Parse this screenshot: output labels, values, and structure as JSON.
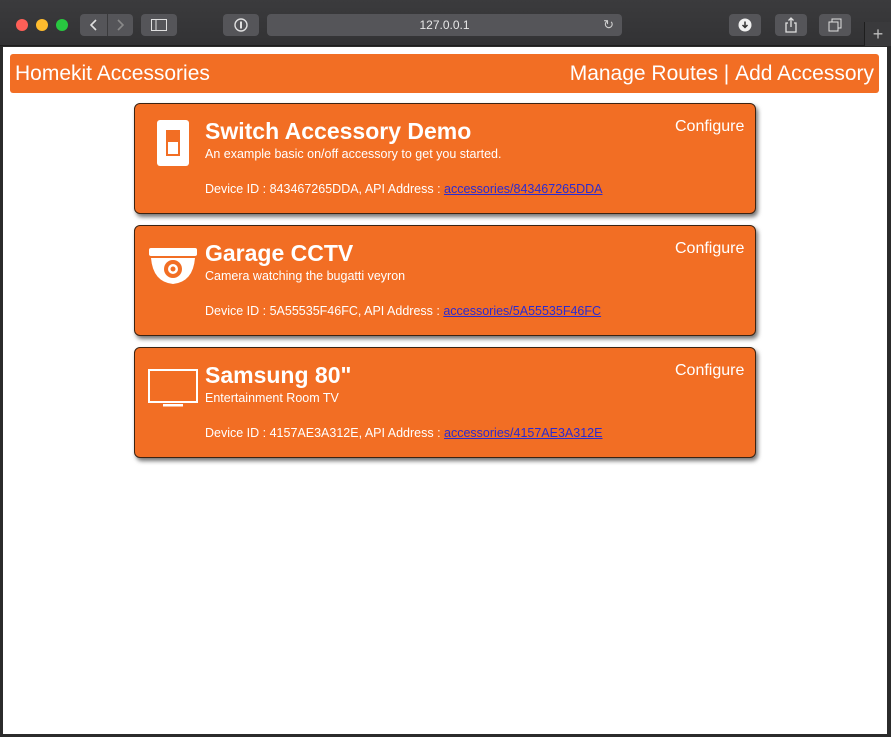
{
  "browser": {
    "url": "127.0.0.1",
    "icons": {
      "back": "chevron-left-icon",
      "forward": "chevron-right-icon",
      "sidebar": "sidebar-icon",
      "reader": "info-icon",
      "reload": "reload-icon",
      "download": "download-icon",
      "share": "share-icon",
      "tabs": "tabs-icon",
      "new_tab": "+"
    }
  },
  "header": {
    "title": "Homekit Accessories",
    "manage_routes": "Manage Routes",
    "separator": " | ",
    "add_accessory": "Add Accessory"
  },
  "accessories": [
    {
      "icon": "switch-icon",
      "name": "Switch Accessory Demo",
      "description": "An example basic on/off accessory to get you started.",
      "configure": "Configure",
      "device_prefix": "Device ID : 843467265DDA, API Address : ",
      "api_link": "accessories/843467265DDA"
    },
    {
      "icon": "security-camera-icon",
      "name": "Garage CCTV",
      "description": "Camera watching the bugatti veyron",
      "configure": "Configure",
      "device_prefix": "Device ID : 5A55535F46FC, API Address : ",
      "api_link": "accessories/5A55535F46FC"
    },
    {
      "icon": "tv-icon",
      "name": "Samsung 80\"",
      "description": "Entertainment Room TV",
      "configure": "Configure",
      "device_prefix": "Device ID : 4157AE3A312E, API Address : ",
      "api_link": "accessories/4157AE3A312E"
    }
  ],
  "colors": {
    "accent": "#f26e24",
    "link": "#2b2bd0"
  }
}
